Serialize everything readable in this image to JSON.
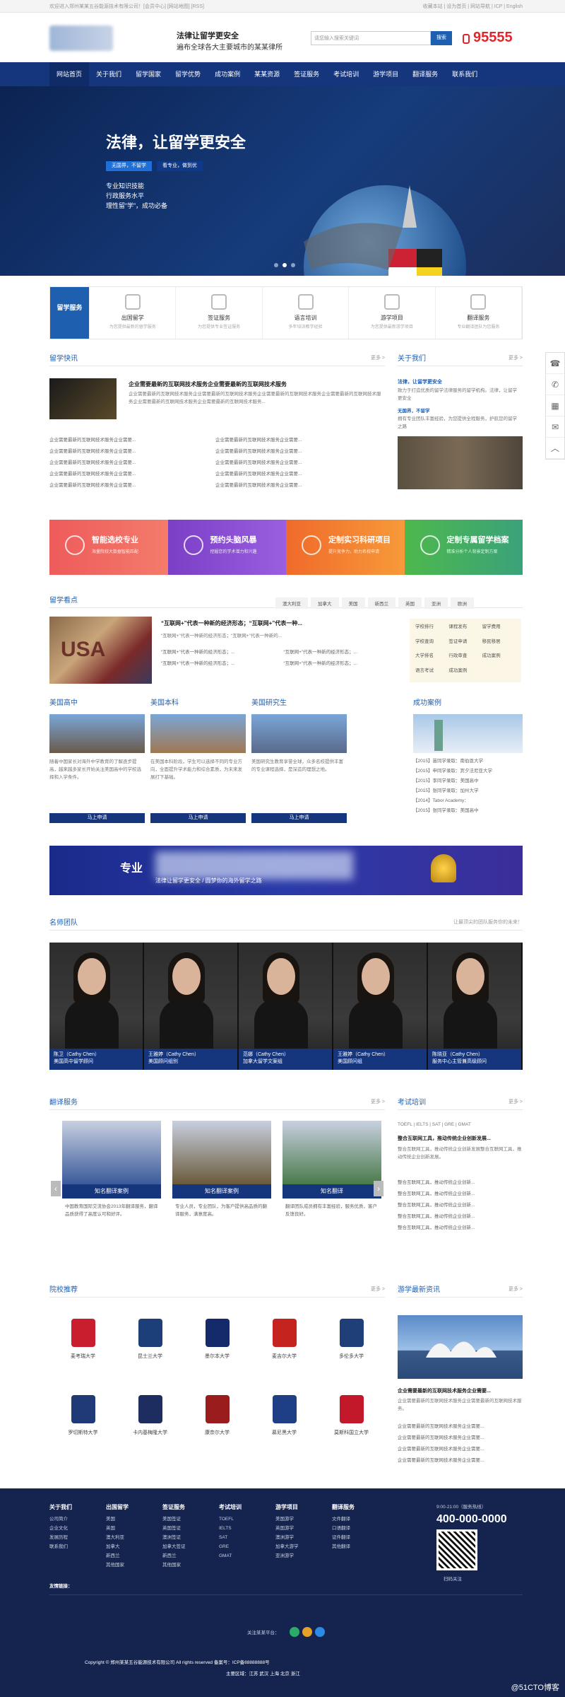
{
  "topbar": {
    "left": "欢迎进入郑州某某五谷能源技术有限公司！[会员中心] [网站地图] [RSS]",
    "right": "收藏本站 | 设为首页 | 网站导航 | ICP | English"
  },
  "header": {
    "slogan1": "法律让留学更安全",
    "slogan2": "遍布全球各大主要城市的某某律所",
    "search_placeholder": "请您输入搜索关键词",
    "search_btn": "搜索",
    "phone": "95555"
  },
  "nav": [
    "网站首页",
    "关于我们",
    "留学国家",
    "留学优势",
    "成功案例",
    "某某资源",
    "签证服务",
    "考试培训",
    "游学项目",
    "翻译服务",
    "联系我们"
  ],
  "banner": {
    "title": "法律，让留学更安全",
    "tag1": "无国界，不留学",
    "tag2": "看专业，做到优",
    "lines": [
      "专业知识技能",
      "行政服务水平",
      "理性留“学”，成功必备"
    ]
  },
  "services": {
    "first": "留学服务",
    "items": [
      {
        "t": "出国留学",
        "s": "为您提供最新的留学服务"
      },
      {
        "t": "签证服务",
        "s": "为您提供专业签证服务"
      },
      {
        "t": "语言培训",
        "s": "多年培训教学经验"
      },
      {
        "t": "游学项目",
        "s": "为您提供最新游学项目"
      },
      {
        "t": "翻译服务",
        "s": "专业翻译团队为您服务"
      }
    ]
  },
  "news": {
    "title": "留学快讯",
    "more": "更多 >",
    "headline": "企业需要最新的互联网技术服务企业需要最新的互联网技术服务",
    "summary": "企业需要最新的互联网技术服务企业需要最新的互联网技术服务企业需要最新的互联网技术服务企业需要最新的互联网技术服务企业需要最新的互联网技术服务企业需要最新的互联网技术服务...",
    "list_left": [
      "企业需要最新的互联网技术服务企业需要...",
      "企业需要最新的互联网技术服务企业需要...",
      "企业需要最新的互联网技术服务企业需要...",
      "企业需要最新的互联网技术服务企业需要...",
      "企业需要最新的互联网技术服务企业需要..."
    ],
    "list_right": [
      "企业需要最新的互联网技术服务企业需要...",
      "企业需要最新的互联网技术服务企业需要...",
      "企业需要最新的互联网技术服务企业需要...",
      "企业需要最新的互联网技术服务企业需要...",
      "企业需要最新的互联网技术服务企业需要..."
    ]
  },
  "about": {
    "title": "关于我们",
    "more": "更多 >",
    "h1": "法律，让留学更安全",
    "p1": "致力于打造优质的留学法律服务的留学机构。法律，让留学更安全",
    "h2": "无国界，不留学",
    "p2": "拥有专业团队丰富经验，为您提供全程服务，护航您的留学之路"
  },
  "cards": [
    {
      "t": "智能选校专业",
      "s": "海量院校大数据智能匹配",
      "c1": "#ee5b5b",
      "c2": "#f47b6b"
    },
    {
      "t": "预约头脑风暴",
      "s": "挖掘您的学术潜力和兴趣",
      "c1": "#7b3fc7",
      "c2": "#9a5ee0"
    },
    {
      "t": "定制实习科研项目",
      "s": "提升竞争力，助力名校申请",
      "c1": "#f06a2a",
      "c2": "#f79a3a"
    },
    {
      "t": "定制专属留学档案",
      "s": "精准分析个人背景定制方案",
      "c1": "#4db84d",
      "c2": "#3aa27a"
    }
  ],
  "focus": {
    "title": "留学看点",
    "tabs": [
      "澳大利亚",
      "加拿大",
      "美国",
      "新西兰",
      "英国",
      "亚洲",
      "欧洲"
    ],
    "headline": "“互联网+”代表一种新的经济形态；“互联网+”代表一种...",
    "sub": "“互联网+”代表一种新的经济形态；“互联网+”代表一种新的...",
    "list": [
      "“互联网+”代表一种新的经济形态；...",
      "“互联网+”代表一种新的经济形态；...",
      "“互联网+”代表一种新的经济形态；...",
      "“互联网+”代表一种新的经济形态；..."
    ],
    "tags": [
      "学校排行",
      "课程发布",
      "留学费用",
      "学校查询",
      "签证申请",
      "移民移居",
      "大学排名",
      "行政审查",
      "成功案例",
      "语言考试",
      "成功案例",
      ""
    ]
  },
  "programs": [
    {
      "t": "美国高中",
      "d": "随着中国家长对海外中学教育的了解逐步提高，越来越多家长开始关注美国高中的学校选择和入学条件。",
      "btn": "马上申请"
    },
    {
      "t": "美国本科",
      "d": "在美国本科阶段，学生可以选择不同的专业方向，全面提升学术能力和综合素质，为未来发展打下基础。",
      "btn": "马上申请"
    },
    {
      "t": "美国研究生",
      "d": "美国研究生教育享誉全球，众多名校提供丰富的专业课程选择，是深造的理想之地。",
      "btn": "马上申请"
    }
  ],
  "cases": {
    "title": "成功案例",
    "items": [
      "【2015】苗同学录取：南伯恩大学",
      "【2015】申同学录取：宾夕法尼亚大学",
      "【2015】李同学录取：美国高中",
      "【2015】张同学录取：加州大学",
      "【2014】Tabor Academy：",
      "【2015】张同学录取：美国高中"
    ]
  },
  "promo": {
    "t1": "专业",
    "t2": "法律让留学更安全 / 圆梦你的海外留学之路"
  },
  "teachers_section": {
    "title": "名师团队",
    "tip": "让最顶尖的团队服务你的未来！"
  },
  "teachers": [
    {
      "name": "陈卫（Cathy Chen）",
      "role": "美国高中留学顾问"
    },
    {
      "name": "王雅婷（Cathy Chen）",
      "role": "美国顾问组别"
    },
    {
      "name": "范娜（Cathy Chen）",
      "role": "加拿大留学文案组"
    },
    {
      "name": "王雅婷（Cathy Chen）",
      "role": "美国顾问组"
    },
    {
      "name": "陈晓亚（Cathy Chen）",
      "role": "服务中心主管兼高级顾问"
    }
  ],
  "translation": {
    "title": "翻译服务",
    "more": "更多 >",
    "items": [
      {
        "cap": "知名翻译案例",
        "d": "中国教育国际交流协会2013年翻译服务，翻译品质获得了高度认可和好评。"
      },
      {
        "cap": "知名翻译案例",
        "d": "专业人员，专业团队，为客户提供高品质的翻译服务，满意度高。"
      },
      {
        "cap": "知名翻译",
        "d": "翻译团队成员拥有丰富经验，服务优质，客户反馈良好。"
      }
    ]
  },
  "exam": {
    "title": "考试培训",
    "more": "更多 >",
    "sub": "TOEFL | IELTS | SAT | GRE | GMAT",
    "headline": "整合互联网工具，推动传统企业创新发展...",
    "p": "整合互联网工具，推动传统企业创新发展整合互联网工具，推动传统企业创新发展。",
    "list": [
      "整合互联网工具，推动传统企业创新...",
      "整合互联网工具，推动传统企业创新...",
      "整合互联网工具，推动传统企业创新...",
      "整合互联网工具，推动传统企业创新...",
      "整合互联网工具，推动传统企业创新..."
    ]
  },
  "unis_section": {
    "title": "院校推荐",
    "more": "更多 >"
  },
  "unis": [
    "麦考瑞大学",
    "昆士兰大学",
    "墨尔本大学",
    "麦吉尔大学",
    "多伦多大学",
    "罗切斯特大学",
    "卡内基梅隆大学",
    "康奈尔大学",
    "慕尼黑大学",
    "莫斯科国立大学"
  ],
  "uni_colors": [
    "#c81e2e",
    "#1c3f7a",
    "#142a6b",
    "#c4231e",
    "#1f3f78",
    "#1f3a76",
    "#1d2d60",
    "#9a1c1c",
    "#1e3e86",
    "#c2182a"
  ],
  "latest": {
    "title": "游学最新资讯",
    "more": "更多 >",
    "headline": "企业需要最新的互联网技术服务企业需要...",
    "p": "企业需要最新的互联网技术服务企业需要最新的互联网技术服务。",
    "list": [
      "企业需要最新的互联网技术服务企业需要...",
      "企业需要最新的互联网技术服务企业需要...",
      "企业需要最新的互联网技术服务企业需要...",
      "企业需要最新的互联网技术服务企业需要..."
    ]
  },
  "footer": {
    "cols": [
      {
        "h": "关于我们",
        "items": [
          "公司简介",
          "企业文化",
          "发展历程",
          "联系我们"
        ]
      },
      {
        "h": "出国留学",
        "items": [
          "美国",
          "英国",
          "澳大利亚",
          "加拿大",
          "新西兰",
          "其他国家"
        ]
      },
      {
        "h": "签证服务",
        "items": [
          "美国签证",
          "英国签证",
          "澳洲签证",
          "加拿大签证",
          "新西兰",
          "其他国家"
        ]
      },
      {
        "h": "考试培训",
        "items": [
          "TOEFL",
          "IELTS",
          "SAT",
          "GRE",
          "GMAT"
        ]
      },
      {
        "h": "游学项目",
        "items": [
          "美国游学",
          "英国游学",
          "澳洲游学",
          "加拿大游学",
          "亚洲游学"
        ]
      },
      {
        "h": "翻译服务",
        "items": [
          "文件翻译",
          "口语翻译",
          "证件翻译",
          "其他翻译"
        ]
      }
    ],
    "hours": "9:00-21:00（服务热线）",
    "tel": "400-000-0000",
    "qr_label": "扫码关注",
    "links": "友情链接：",
    "follow": "关注某某平台：",
    "copyright": "Copyright © 郑州某某五谷能源技术有限公司 All rights reserved 备案号：ICP备88888888号",
    "areas": "主要区域：江苏 武汉 上海 北京 浙江"
  },
  "sidebar": [
    "☎",
    "✆",
    "▦",
    "✉",
    "︿"
  ],
  "watermark": "@51CTO博客",
  "colors": {
    "brand": "#15357c",
    "accent": "#1f5fb0",
    "phone": "#e0262b"
  }
}
